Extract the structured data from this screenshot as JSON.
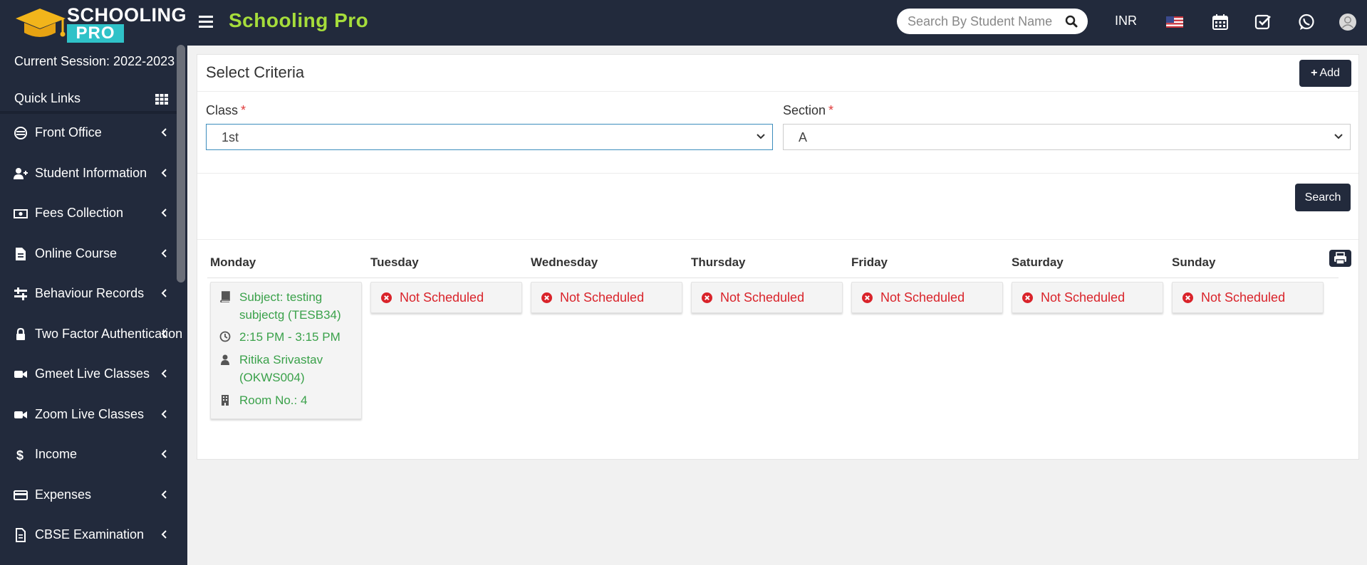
{
  "brand": {
    "logo_line1": "SCHOOLING",
    "logo_line2": "PRO",
    "app_title": "Schooling Pro",
    "accent": "#a6dd3b",
    "dark": "#222a3c"
  },
  "header": {
    "search_placeholder": "Search By Student Name",
    "currency": "INR",
    "icons": [
      "us-flag-icon",
      "calendar-icon",
      "checklist-icon",
      "whatsapp-icon",
      "user-avatar-icon"
    ]
  },
  "sidebar": {
    "session": "Current Session: 2022-2023",
    "quick_links": "Quick Links",
    "items": [
      {
        "label": "Front Office",
        "icon": "front-office-icon"
      },
      {
        "label": "Student Information",
        "icon": "user-plus-icon"
      },
      {
        "label": "Fees Collection",
        "icon": "money-icon"
      },
      {
        "label": "Online Course",
        "icon": "file-icon"
      },
      {
        "label": "Behaviour Records",
        "icon": "sliders-icon"
      },
      {
        "label": "Two Factor Authentication",
        "icon": "lock-icon"
      },
      {
        "label": "Gmeet Live Classes",
        "icon": "video-icon"
      },
      {
        "label": "Zoom Live Classes",
        "icon": "video-icon"
      },
      {
        "label": "Income",
        "icon": "dollar-icon"
      },
      {
        "label": "Expenses",
        "icon": "credit-card-icon"
      },
      {
        "label": "CBSE Examination",
        "icon": "document-icon"
      }
    ]
  },
  "main": {
    "title": "Select Criteria",
    "add_label": "Add",
    "class_label": "Class",
    "class_value": "1st",
    "section_label": "Section",
    "section_value": "A",
    "required_mark": "*",
    "search_label": "Search"
  },
  "timetable": {
    "days": [
      "Monday",
      "Tuesday",
      "Wednesday",
      "Thursday",
      "Friday",
      "Saturday",
      "Sunday"
    ],
    "monday": {
      "subject": "Subject: testing subjectg (TESB34)",
      "time": "2:15 PM - 3:15 PM",
      "teacher": "Ritika Srivastav (OKWS004)",
      "room": "Room No.: 4"
    },
    "not_scheduled": "Not Scheduled"
  }
}
